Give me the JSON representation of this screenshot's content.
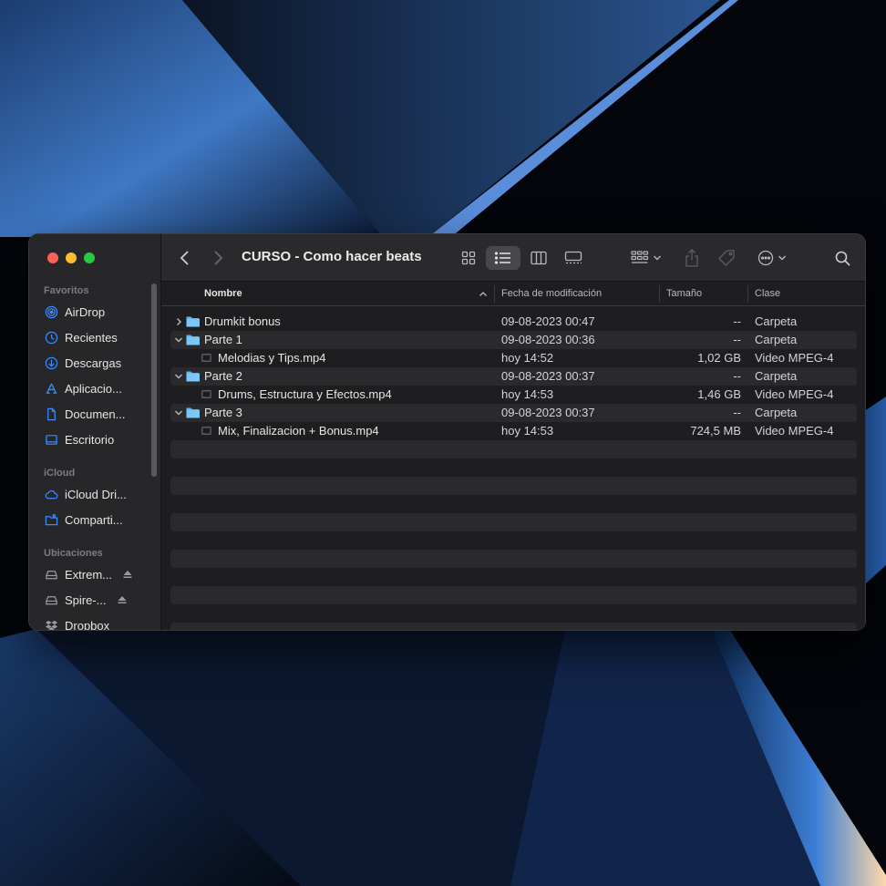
{
  "window": {
    "title": "CURSO - Como hacer beats"
  },
  "sidebar": {
    "sections": [
      {
        "title": "Favoritos",
        "items": [
          {
            "label": "AirDrop",
            "icon": "airdrop-icon"
          },
          {
            "label": "Recientes",
            "icon": "clock-icon"
          },
          {
            "label": "Descargas",
            "icon": "download-icon"
          },
          {
            "label": "Aplicacio...",
            "icon": "apps-icon"
          },
          {
            "label": "Documen...",
            "icon": "document-icon"
          },
          {
            "label": "Escritorio",
            "icon": "desktop-icon"
          }
        ]
      },
      {
        "title": "iCloud",
        "items": [
          {
            "label": "iCloud Dri...",
            "icon": "cloud-icon"
          },
          {
            "label": "Comparti...",
            "icon": "shared-folder-icon"
          }
        ]
      },
      {
        "title": "Ubicaciones",
        "items": [
          {
            "label": "Extrem...",
            "icon": "drive-icon",
            "eject": true
          },
          {
            "label": "Spire-...",
            "icon": "drive-icon",
            "eject": true
          },
          {
            "label": "Dropbox",
            "icon": "dropbox-icon"
          }
        ]
      }
    ]
  },
  "columns": {
    "name": "Nombre",
    "date": "Fecha de modificación",
    "size": "Tamaño",
    "kind": "Clase"
  },
  "rows": [
    {
      "name": "Drumkit bonus",
      "type": "folder",
      "expanded": false,
      "level": 0,
      "date": "09-08-2023 00:47",
      "size": "--",
      "kind": "Carpeta"
    },
    {
      "name": "Parte 1",
      "type": "folder",
      "expanded": true,
      "level": 0,
      "date": "09-08-2023 00:36",
      "size": "--",
      "kind": "Carpeta"
    },
    {
      "name": "Melodias y Tips.mp4",
      "type": "video",
      "level": 1,
      "date": "hoy 14:52",
      "size": "1,02 GB",
      "kind": "Video MPEG-4"
    },
    {
      "name": "Parte 2",
      "type": "folder",
      "expanded": true,
      "level": 0,
      "date": "09-08-2023 00:37",
      "size": "--",
      "kind": "Carpeta"
    },
    {
      "name": "Drums, Estructura y Efectos.mp4",
      "type": "video",
      "level": 1,
      "date": "hoy 14:53",
      "size": "1,46 GB",
      "kind": "Video MPEG-4"
    },
    {
      "name": "Parte 3",
      "type": "folder",
      "expanded": true,
      "level": 0,
      "date": "09-08-2023 00:37",
      "size": "--",
      "kind": "Carpeta"
    },
    {
      "name": "Mix, Finalizacion + Bonus.mp4",
      "type": "video",
      "level": 1,
      "date": "hoy 14:53",
      "size": "724,5 MB",
      "kind": "Video MPEG-4"
    }
  ],
  "colors": {
    "folder": "#5bb6f5",
    "accent": "#0a84ff"
  }
}
